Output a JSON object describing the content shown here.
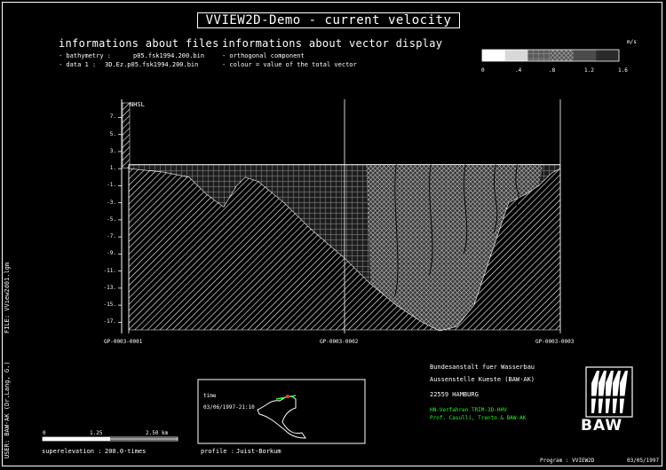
{
  "window": {
    "title": "VVIEW2D-Demo  -  current velocity"
  },
  "files": {
    "heading": "informations about files",
    "bathymetry_label": "- bathymetry :",
    "bathymetry_value": "p05.fsk1994.200.bin",
    "data_label": "- data 1 :",
    "data_value": "3D.Ez.p05.fsk1994.200.bin"
  },
  "vector_display": {
    "heading": "informations about vector display",
    "line1": "- orthogonal component",
    "line2": "- colour = value of the total vector"
  },
  "legend": {
    "unit": "m/s",
    "ticks": [
      "0",
      ".4",
      ".8",
      "1.2",
      "1.6"
    ],
    "colors": [
      "#ffffff",
      "#d8d8d8",
      "#a8a8a8",
      "#7a7a7a",
      "#4a4a4a",
      "#2a2a2a"
    ]
  },
  "chart_data": {
    "type": "heatmap",
    "title": "VVIEW2D-Demo  -  current velocity",
    "ylabel": "NHSL",
    "ylim": [
      -18,
      8.5
    ],
    "yticks": [
      "7.",
      "5.",
      "3.",
      "1.",
      "-1.",
      "-3.",
      "-5.",
      "-7.",
      "-9.",
      "-11.",
      "-13.",
      "-15.",
      "-17."
    ],
    "x_stations": [
      "GP-0003-0001",
      "GP-0003-0002",
      "GP-0003-0003"
    ],
    "x_station_positions": [
      0,
      0.5,
      1
    ],
    "water_surface": 1.5,
    "bed_profile": {
      "x": [
        0,
        0.08,
        0.14,
        0.18,
        0.22,
        0.25,
        0.27,
        0.3,
        0.36,
        0.42,
        0.5,
        0.56,
        0.62,
        0.68,
        0.72,
        0.76,
        0.8,
        0.84,
        0.88,
        0.92,
        0.95,
        0.98,
        1.0
      ],
      "y": [
        1.0,
        0.6,
        0.0,
        -2.0,
        -3.5,
        -1.0,
        0.0,
        -0.5,
        -3.0,
        -6.0,
        -9.5,
        -12.5,
        -15.0,
        -17.0,
        -18.0,
        -17.5,
        -15.0,
        -9.0,
        -3.0,
        -2.0,
        -1.0,
        0.5,
        1.0
      ]
    },
    "velocity_classes": [
      0,
      0.4,
      0.8,
      1.2,
      1.6
    ],
    "velocity_unit": "m/s"
  },
  "scale_bar": {
    "ticks": [
      "0",
      "1.25",
      "2.50 km"
    ],
    "superelevation_label": "superelevation :",
    "superelevation_value": "200.0-times"
  },
  "overview_map": {
    "caption1": "time",
    "caption2": "03/06/1997-21:10",
    "profile_label": "profile :",
    "profile_value": "Juist-Borkum"
  },
  "institution": {
    "line1": "Bundesanstalt fuer Wasserbau",
    "line2": "Aussenstelle Kueste (BAW-AK)",
    "line3": "22559 HAMBURG",
    "line4": "HN-Verfahren TRIM-3D-HHV",
    "line5": "Prof. Casulli, Trento & BAW-AK",
    "logo_text": "BAW"
  },
  "side_labels": {
    "file": "FILE: VView2d01.lgm",
    "user": "USER: BAW-AK (Dr.Lang, G.)"
  },
  "footer": {
    "program_label": "Program : VVIEW2D",
    "date": "03/05/1997"
  }
}
